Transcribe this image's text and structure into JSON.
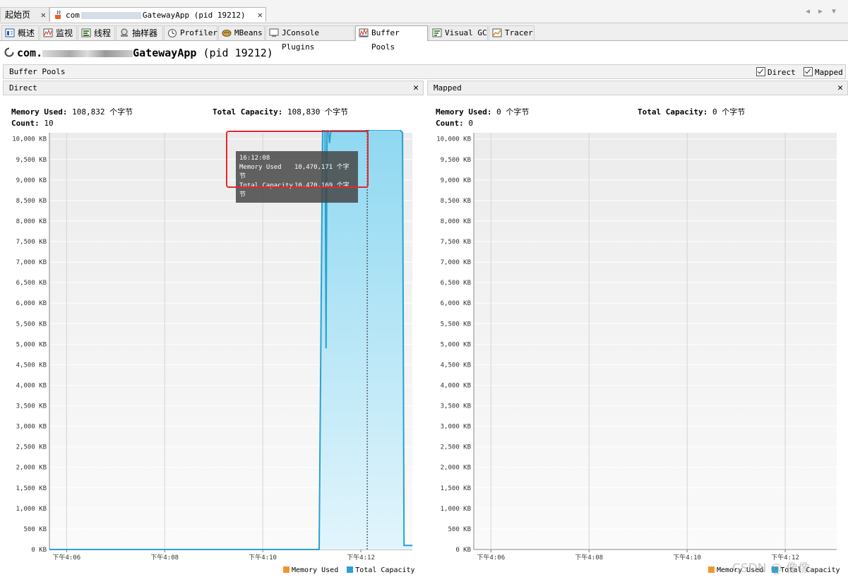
{
  "doc_tabs": [
    {
      "label": "起始页",
      "active": false
    },
    {
      "label": "com█████████████GatewayApp (pid 19212)",
      "label_prefix": "com",
      "label_suffix": "GatewayApp (pid 19212)",
      "active": true
    }
  ],
  "tool_tabs": [
    {
      "label": "概述",
      "icon": "overview-icon"
    },
    {
      "label": "监视",
      "icon": "monitor-icon"
    },
    {
      "label": "线程",
      "icon": "threads-icon"
    },
    {
      "label": "抽样器",
      "icon": "sampler-icon"
    },
    {
      "label": "Profiler",
      "icon": "profiler-icon"
    },
    {
      "label": "MBeans",
      "icon": "mbeans-icon"
    },
    {
      "label": "JConsole Plugins",
      "icon": "jconsole-icon"
    },
    {
      "label": "Buffer Pools",
      "icon": "buffer-pools-icon",
      "active": true
    },
    {
      "label": "Visual GC",
      "icon": "visual-gc-icon"
    },
    {
      "label": "Tracer",
      "icon": "tracer-icon"
    }
  ],
  "app": {
    "title_prefix": "com.",
    "title_main": "GatewayApp",
    "title_pid": "(pid 19212)"
  },
  "buffer_pools": {
    "label": "Buffer Pools",
    "direct_checkbox": "Direct",
    "mapped_checkbox": "Mapped",
    "direct_checked": true,
    "mapped_checked": true
  },
  "direct": {
    "title": "Direct",
    "memory_used_label": "Memory Used:",
    "memory_used_value": "108,832 个字节",
    "total_capacity_label": "Total Capacity:",
    "total_capacity_value": "108,830 个字节",
    "count_label": "Count:",
    "count_value": "10",
    "tooltip": {
      "time": "16:12:08",
      "memory_used_label": "Memory Used",
      "memory_used_value": "10,470,171 个字节",
      "total_capacity_label": "Total Capacity",
      "total_capacity_value": "10,470,169 个字节"
    }
  },
  "mapped": {
    "title": "Mapped",
    "memory_used_label": "Memory Used:",
    "memory_used_value": "0 个字节",
    "total_capacity_label": "Total Capacity:",
    "total_capacity_value": "0 个字节",
    "count_label": "Count:",
    "count_value": "0"
  },
  "legend": {
    "memory_used": "Memory Used",
    "total_capacity": "Total Capacity"
  },
  "colors": {
    "memory_used": "#f0962e",
    "total_capacity": "#2aa1cf",
    "highlight_box": "#e8262a"
  },
  "watermark": "CSDN @ 像像",
  "chart_data": [
    {
      "type": "area",
      "title": "Direct",
      "ylim": [
        0,
        10000
      ],
      "y_ticks": [
        "0 KB",
        "500 KB",
        "1,000 KB",
        "1,500 KB",
        "2,000 KB",
        "2,500 KB",
        "3,000 KB",
        "3,500 KB",
        "4,000 KB",
        "4,500 KB",
        "5,000 KB",
        "5,500 KB",
        "6,000 KB",
        "6,500 KB",
        "7,000 KB",
        "7,500 KB",
        "8,000 KB",
        "8,500 KB",
        "9,000 KB",
        "9,500 KB",
        "10,000 KB"
      ],
      "x_ticks": [
        "下午4:06",
        "下午4:08",
        "下午4:10",
        "下午4:12"
      ],
      "x_tick_minutes": [
        6,
        8,
        10,
        12
      ],
      "xlim_minutes": [
        5.65,
        13.05
      ],
      "series": [
        {
          "name": "Total Capacity",
          "points": [
            [
              5.65,
              0
            ],
            [
              11.15,
              0
            ],
            [
              11.22,
              10220
            ],
            [
              11.27,
              10220
            ],
            [
              11.29,
              4900
            ],
            [
              11.31,
              10220
            ],
            [
              11.34,
              10220
            ],
            [
              11.36,
              9900
            ],
            [
              11.39,
              10220
            ],
            [
              12.8,
              10220
            ],
            [
              12.85,
              10150
            ],
            [
              12.88,
              100
            ],
            [
              13.05,
              100
            ]
          ]
        }
      ],
      "cursor_minute": 12.13
    },
    {
      "type": "area",
      "title": "Mapped",
      "ylim": [
        0,
        10000
      ],
      "y_ticks": [
        "0 KB",
        "500 KB",
        "1,000 KB",
        "1,500 KB",
        "2,000 KB",
        "2,500 KB",
        "3,000 KB",
        "3,500 KB",
        "4,000 KB",
        "4,500 KB",
        "5,000 KB",
        "5,500 KB",
        "6,000 KB",
        "6,500 KB",
        "7,000 KB",
        "7,500 KB",
        "8,000 KB",
        "8,500 KB",
        "9,000 KB",
        "9,500 KB",
        "10,000 KB"
      ],
      "x_ticks": [
        "下午4:06",
        "下午4:08",
        "下午4:10",
        "下午4:12"
      ],
      "x_tick_minutes": [
        6,
        8,
        10,
        12
      ],
      "xlim_minutes": [
        5.65,
        13.05
      ],
      "series": []
    }
  ]
}
